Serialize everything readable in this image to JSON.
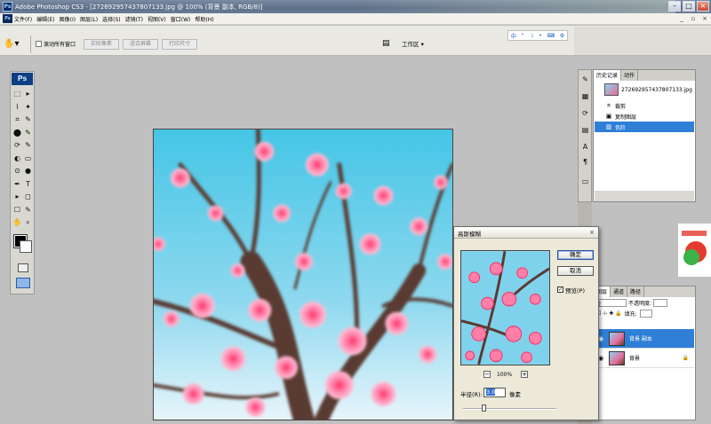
{
  "window": {
    "title": "Adobe Photoshop CS3 - [272692957437807133.jpg @ 100% (背景 副本, RGB/8)]",
    "logo": "Ps"
  },
  "menu": [
    "文件(F)",
    "编辑(E)",
    "图像(I)",
    "图层(L)",
    "选择(S)",
    "滤镜(T)",
    "视图(V)",
    "窗口(W)",
    "帮助(H)"
  ],
  "options": {
    "scroll_all_label": "滚动所有窗口",
    "buttons": [
      "实际像素",
      "适合屏幕",
      "打印尺寸"
    ],
    "workspace": "工作区 ▾"
  },
  "ime": [
    "中",
    "°",
    "☽",
    "•",
    "⌨",
    "⚙"
  ],
  "tools": {
    "logo": "Ps",
    "icons": [
      "⬚",
      "▸",
      "⌇",
      "✦",
      "⌗",
      "✎",
      "⬤",
      "✎",
      "⟳",
      "✎",
      "◐",
      "▭",
      "⊙",
      "●",
      "✒",
      "T",
      "▸",
      "◻",
      "☐",
      "✎",
      "✋",
      "⌕"
    ]
  },
  "history": {
    "tabs": [
      "历史记录",
      "动作"
    ],
    "snapshot": "272692957437807133.jpg",
    "items": [
      {
        "icon": "crop-icon",
        "label": "裁剪"
      },
      {
        "icon": "layer-icon",
        "label": "复制图层"
      },
      {
        "icon": "levels-icon",
        "label": "色阶"
      }
    ]
  },
  "layers": {
    "tabs": [
      "图层",
      "通道",
      "路径"
    ],
    "opacity_label": "不透明度:",
    "fill_label": "填充:",
    "mode_fragment": "常",
    "items": [
      {
        "name": "背景 副本",
        "selected": true
      },
      {
        "name": "背景",
        "selected": false
      }
    ]
  },
  "dialog": {
    "title": "高斯模糊",
    "ok": "确定",
    "cancel": "取消",
    "preview_label": "预览(P)",
    "zoom": "100%",
    "radius_label": "半径(R):",
    "radius_value": "3.0",
    "radius_unit": "像素",
    "slider_fraction": 0.2,
    "preview_checked": true
  },
  "colors": {
    "history_selection": "#2f7fd6",
    "sky": "#8fd4ef",
    "blossom": "#e46d9c"
  }
}
